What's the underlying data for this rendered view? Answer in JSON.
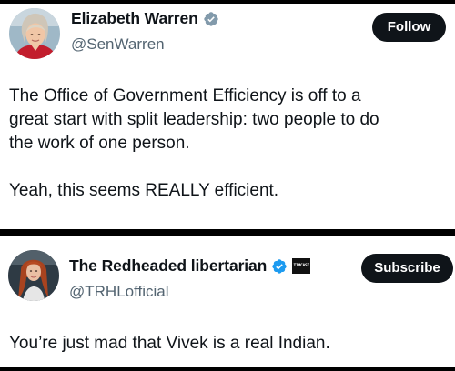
{
  "tweets": [
    {
      "display_name": "Elizabeth Warren",
      "handle": "@SenWarren",
      "verified_icon": "verified-badge-icon",
      "action_label": "Follow",
      "text_lines": [
        "The Office of Government Efficiency is off to a",
        "great start with split leadership:  two people to do",
        "the work of one person.",
        "Yeah, this seems REALLY efficient."
      ]
    },
    {
      "display_name": "The Redheaded libertarian",
      "handle": "@TRHLofficial",
      "verified_icon": "verified-badge-icon",
      "affiliate_badge": "TIMCAST",
      "action_label": "Subscribe",
      "text": "You’re just mad that Vivek is a real Indian."
    }
  ],
  "colors": {
    "background": "#000000",
    "card": "#ffffff",
    "text": "#0f1419",
    "secondary_text": "#536471",
    "verified": "#1d9bf0",
    "button": "#0f1419",
    "button_text": "#ffffff"
  }
}
